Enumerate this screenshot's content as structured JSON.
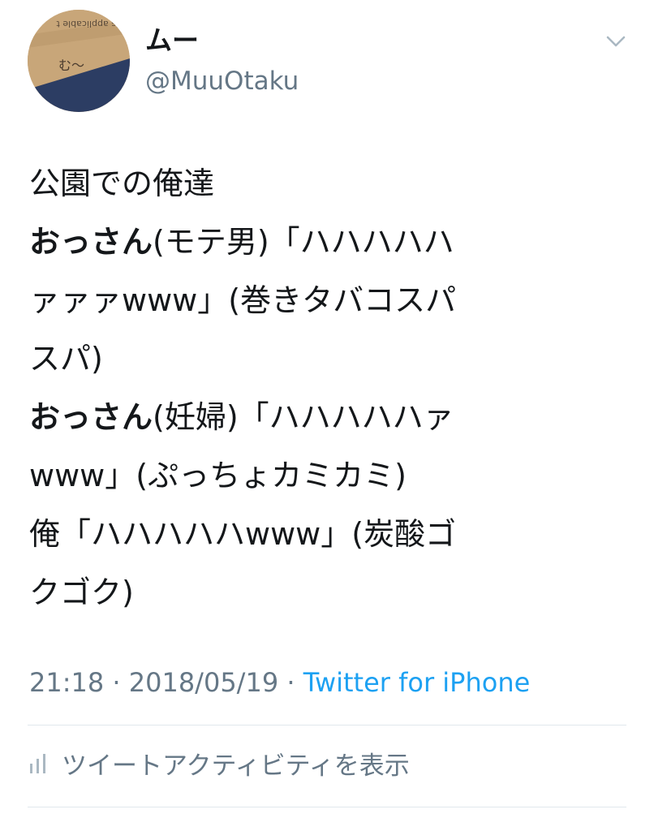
{
  "user": {
    "display_name": "ムー",
    "handle": "@MuuOtaku",
    "avatar_text": "む〜",
    "avatar_paper_text": "is applicable t"
  },
  "tweet": {
    "lines": [
      {
        "bold": "",
        "text": "公園での俺達"
      },
      {
        "bold": "おっさん",
        "text": "(モテ男)「ハハハハハ"
      },
      {
        "bold": "",
        "text": "ァァァwww」(巻きタバコスパ"
      },
      {
        "bold": "",
        "text": "スパ)"
      },
      {
        "bold": "おっさん",
        "text": "(妊婦)「ハハハハハァ"
      },
      {
        "bold": "",
        "text": "www」(ぷっちょカミカミ)"
      },
      {
        "bold": "",
        "text": "俺「ハハハハハwww」(炭酸ゴ"
      },
      {
        "bold": "",
        "text": "クゴク)"
      }
    ]
  },
  "meta": {
    "time": "21:18",
    "separator": " · ",
    "date": "2018/05/19",
    "source": "Twitter for iPhone"
  },
  "activity": {
    "label": "ツイートアクティビティを表示",
    "icon": "bar-chart-icon"
  },
  "colors": {
    "text": "#14171a",
    "secondary": "#657786",
    "link": "#1da1f2",
    "divider": "#e1e8ed"
  }
}
